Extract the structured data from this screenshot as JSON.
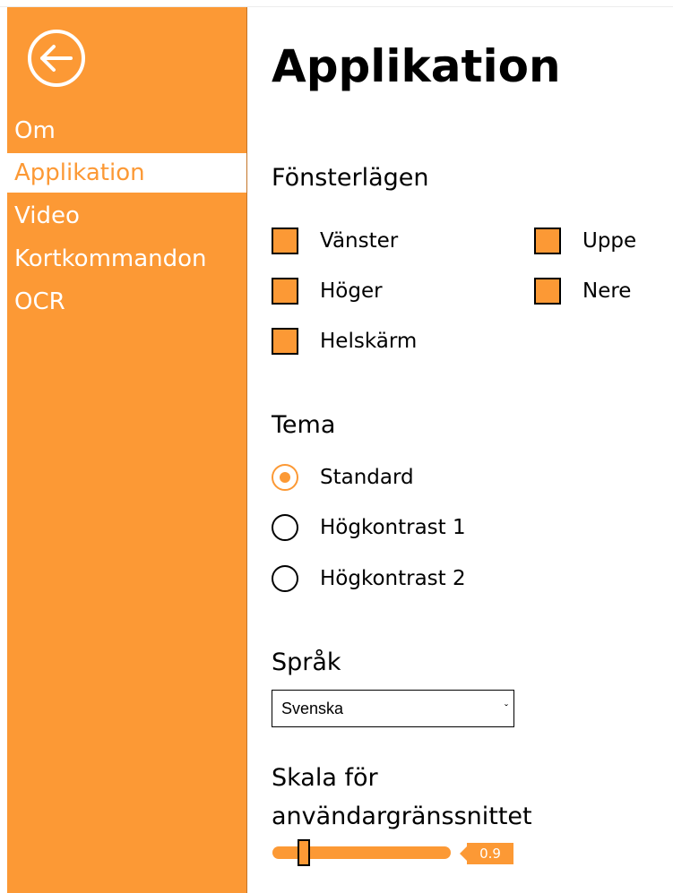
{
  "colors": {
    "accent": "#fc9935",
    "text": "#000000",
    "background": "#ffffff"
  },
  "sidebar": {
    "back_icon": "arrow-left-circle-icon",
    "items": [
      {
        "label": "Om",
        "active": false
      },
      {
        "label": "Applikation",
        "active": true
      },
      {
        "label": "Video",
        "active": false
      },
      {
        "label": "Kortkommandon",
        "active": false
      },
      {
        "label": "OCR",
        "active": false
      }
    ]
  },
  "main": {
    "title": "Applikation",
    "window_modes": {
      "heading": "Fönsterlägen",
      "options": [
        {
          "label": "Vänster"
        },
        {
          "label": "Uppe"
        },
        {
          "label": "Höger"
        },
        {
          "label": "Nere"
        },
        {
          "label": "Helskärm"
        }
      ]
    },
    "theme": {
      "heading": "Tema",
      "options": [
        {
          "label": "Standard",
          "selected": true
        },
        {
          "label": "Högkontrast 1",
          "selected": false
        },
        {
          "label": "Högkontrast 2",
          "selected": false
        }
      ]
    },
    "language": {
      "heading": "Språk",
      "selected": "Svenska",
      "chevron": "ˇ"
    },
    "ui_scale": {
      "heading_line1": "Skala för",
      "heading_line2": "användargränssnittet",
      "value": "0.9"
    }
  }
}
